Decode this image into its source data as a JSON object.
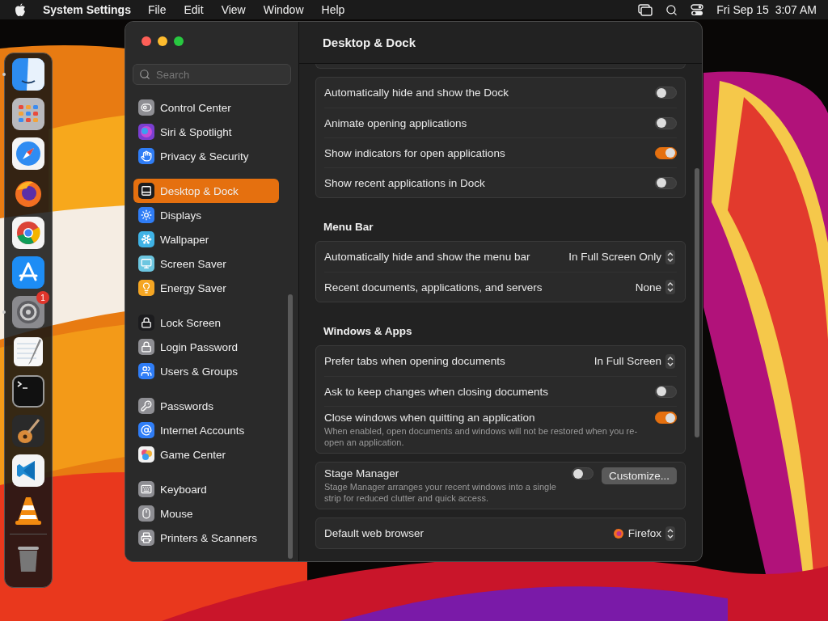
{
  "menu_bar": {
    "app_name": "System Settings",
    "menus": [
      "File",
      "Edit",
      "View",
      "Window",
      "Help"
    ],
    "clock": "Fri Sep 15  3:07 AM"
  },
  "dock": {
    "items": [
      {
        "kind": "finder",
        "running": true
      },
      {
        "kind": "launchpad",
        "running": false
      },
      {
        "kind": "safari",
        "running": false
      },
      {
        "kind": "firefox",
        "running": false
      },
      {
        "kind": "chrome",
        "running": false
      },
      {
        "kind": "appstore",
        "running": false
      },
      {
        "kind": "settings",
        "running": true,
        "badge": "1"
      },
      {
        "kind": "textedit",
        "running": false
      },
      {
        "kind": "terminal",
        "running": false
      },
      {
        "kind": "guitar",
        "running": false
      },
      {
        "kind": "code",
        "running": false
      },
      {
        "kind": "cone",
        "running": false
      },
      {
        "kind": "trash",
        "running": false
      }
    ]
  },
  "window": {
    "title": "Desktop & Dock"
  },
  "sidebar": {
    "search": {
      "placeholder": "Search"
    },
    "groups": [
      {
        "items": [
          {
            "label": "Control Center",
            "color": "#8e8e93",
            "selected": false
          },
          {
            "label": "Siri & Spotlight",
            "color": "#7a3fd1",
            "selected": false
          },
          {
            "label": "Privacy & Security",
            "color": "#2f7df6",
            "selected": false
          }
        ]
      },
      {
        "items": [
          {
            "label": "Desktop & Dock",
            "color": "#1c1c1e",
            "selected": true
          },
          {
            "label": "Displays",
            "color": "#2f7df6",
            "selected": false
          },
          {
            "label": "Wallpaper",
            "color": "#3fb3e6",
            "selected": false
          },
          {
            "label": "Screen Saver",
            "color": "#6cc6e0",
            "selected": false
          },
          {
            "label": "Energy Saver",
            "color": "#f5a623",
            "selected": false
          }
        ]
      },
      {
        "items": [
          {
            "label": "Lock Screen",
            "color": "#1c1c1e",
            "selected": false
          },
          {
            "label": "Login Password",
            "color": "#8e8e93",
            "selected": false
          },
          {
            "label": "Users & Groups",
            "color": "#2f7df6",
            "selected": false
          }
        ]
      },
      {
        "items": [
          {
            "label": "Passwords",
            "color": "#8e8e93",
            "selected": false
          },
          {
            "label": "Internet Accounts",
            "color": "#2f7df6",
            "selected": false
          },
          {
            "label": "Game Center",
            "color": "#f2f2f2",
            "selected": false
          }
        ]
      },
      {
        "items": [
          {
            "label": "Keyboard",
            "color": "#8e8e93",
            "selected": false
          },
          {
            "label": "Mouse",
            "color": "#8e8e93",
            "selected": false
          },
          {
            "label": "Printers & Scanners",
            "color": "#8e8e93",
            "selected": false
          }
        ]
      }
    ]
  },
  "content": {
    "sections": [
      {
        "cards": [
          {
            "rows": [
              {
                "kind": "toggle",
                "label": "Automatically hide and show the Dock",
                "on": false
              },
              {
                "kind": "toggle",
                "label": "Animate opening applications",
                "on": false
              },
              {
                "kind": "toggle",
                "label": "Show indicators for open applications",
                "on": true
              },
              {
                "kind": "toggle",
                "label": "Show recent applications in Dock",
                "on": false
              }
            ]
          }
        ]
      },
      {
        "heading": "Menu Bar",
        "cards": [
          {
            "rows": [
              {
                "kind": "popup",
                "label": "Automatically hide and show the menu bar",
                "value": "In Full Screen Only"
              },
              {
                "kind": "popup",
                "label": "Recent documents, applications, and servers",
                "value": "None"
              }
            ]
          }
        ]
      },
      {
        "heading": "Windows & Apps",
        "cards": [
          {
            "rows": [
              {
                "kind": "popup",
                "label": "Prefer tabs when opening documents",
                "value": "In Full Screen"
              },
              {
                "kind": "toggle",
                "label": "Ask to keep changes when closing documents",
                "on": false
              },
              {
                "kind": "toggle",
                "label": "Close windows when quitting an application",
                "on": true,
                "description": "When enabled, open documents and windows will not be restored when you re-open an application."
              }
            ]
          },
          {
            "rows": [
              {
                "kind": "toggle_button",
                "label": "Stage Manager",
                "on": false,
                "button": "Customize...",
                "description": "Stage Manager arranges your recent windows into a single strip for reduced clutter and quick access."
              }
            ]
          },
          {
            "rows": [
              {
                "kind": "app_popup",
                "label": "Default web browser",
                "value": "Firefox"
              }
            ]
          }
        ]
      }
    ]
  }
}
